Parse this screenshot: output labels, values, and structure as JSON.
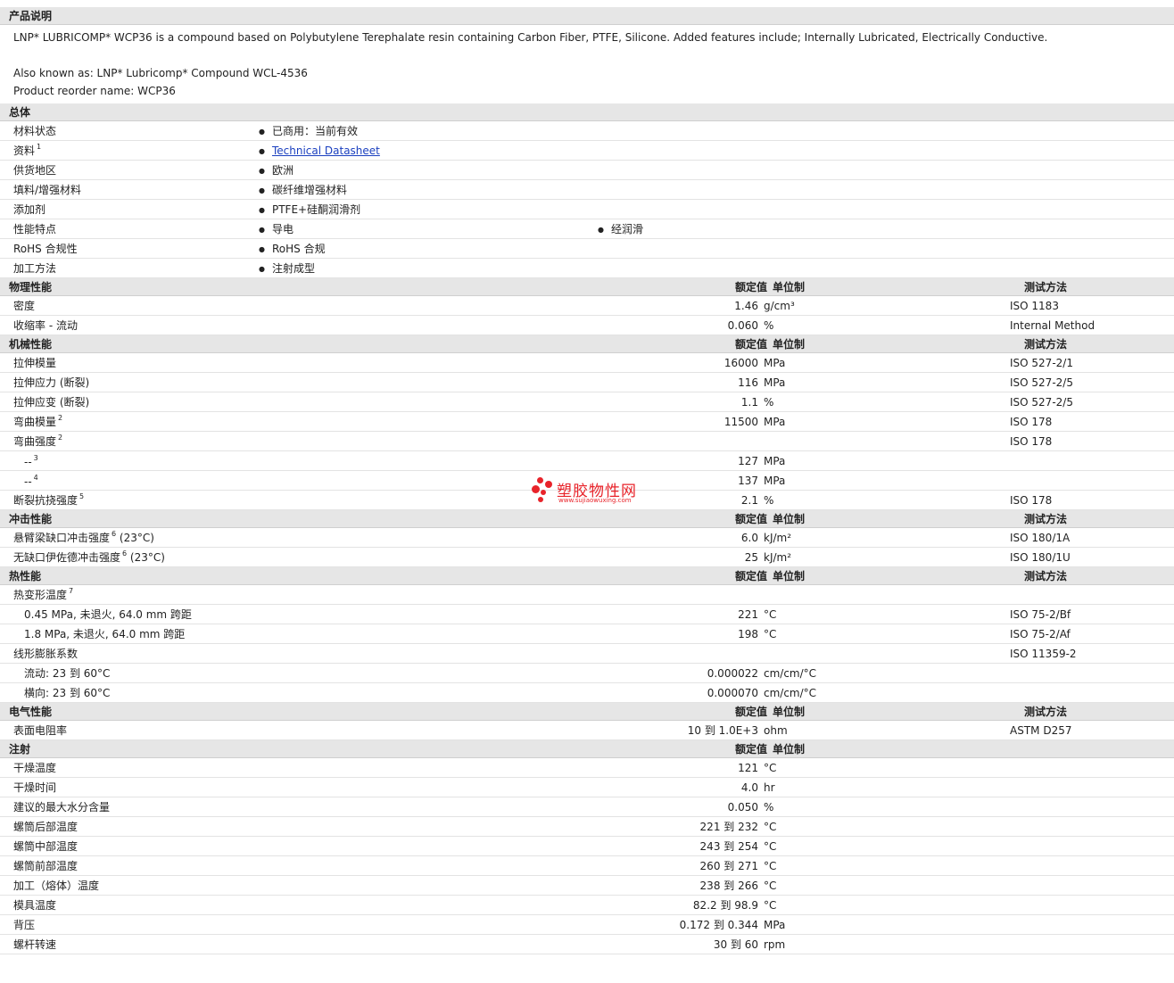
{
  "description": {
    "title": "产品说明",
    "line1": "LNP* LUBRICOMP* WCP36 is a compound based on Polybutylene Terephalate resin containing Carbon Fiber, PTFE, Silicone. Added features include; Internally Lubricated, Electrically Conductive.",
    "line2": "Also known as: LNP* Lubricomp* Compound WCL-4536",
    "line3": "Product reorder name: WCP36"
  },
  "general": {
    "title": "总体",
    "rows": [
      {
        "label": "材料状态",
        "sup": "",
        "v1": "已商用：当前有效",
        "v2": ""
      },
      {
        "label": "资料",
        "sup": "1",
        "v1": "Technical Datasheet",
        "v2": "",
        "link": true
      },
      {
        "label": "供货地区",
        "sup": "",
        "v1": "欧洲",
        "v2": ""
      },
      {
        "label": "填料/增强材料",
        "sup": "",
        "v1": "碳纤维增强材料",
        "v2": ""
      },
      {
        "label": "添加剂",
        "sup": "",
        "v1": "PTFE+硅酮润滑剂",
        "v2": ""
      },
      {
        "label": "性能特点",
        "sup": "",
        "v1": "导电",
        "v2": "经润滑"
      },
      {
        "label": "RoHS 合规性",
        "sup": "",
        "v1": "RoHS 合规",
        "v2": ""
      },
      {
        "label": "加工方法",
        "sup": "",
        "v1": "注射成型",
        "v2": ""
      }
    ]
  },
  "columns": {
    "value": "额定值",
    "unit": "单位制",
    "method": "测试方法"
  },
  "sections": [
    {
      "title": "物理性能",
      "show_method": true,
      "rows": [
        {
          "label": "密度",
          "sup": "",
          "sub": false,
          "value": "1.46",
          "unit": "g/cm³",
          "method": "ISO 1183"
        },
        {
          "label": "收缩率  - 流动",
          "sup": "",
          "sub": false,
          "value": "0.060",
          "unit": "%",
          "method": "Internal Method"
        }
      ]
    },
    {
      "title": "机械性能",
      "show_method": true,
      "rows": [
        {
          "label": "拉伸模量",
          "sup": "",
          "sub": false,
          "value": "16000",
          "unit": "MPa",
          "method": "ISO 527-2/1"
        },
        {
          "label": "拉伸应力  (断裂)",
          "sup": "",
          "sub": false,
          "value": "116",
          "unit": "MPa",
          "method": "ISO 527-2/5"
        },
        {
          "label": "拉伸应变  (断裂)",
          "sup": "",
          "sub": false,
          "value": "1.1",
          "unit": "%",
          "method": "ISO 527-2/5"
        },
        {
          "label": "弯曲模量",
          "sup": "2",
          "sub": false,
          "value": "11500",
          "unit": "MPa",
          "method": "ISO 178"
        },
        {
          "label": "弯曲强度",
          "sup": "2",
          "sub": false,
          "value": "",
          "unit": "",
          "method": "ISO 178"
        },
        {
          "label": "--",
          "sup": "3",
          "sub": true,
          "value": "127",
          "unit": "MPa",
          "method": ""
        },
        {
          "label": "--",
          "sup": "4",
          "sub": true,
          "value": "137",
          "unit": "MPa",
          "method": ""
        },
        {
          "label": "断裂抗挠强度",
          "sup": "5",
          "sub": false,
          "value": "2.1",
          "unit": "%",
          "method": "ISO 178"
        }
      ]
    },
    {
      "title": "冲击性能",
      "show_method": true,
      "rows": [
        {
          "label": "悬臂梁缺口冲击强度",
          "sup": "6",
          "after": " (23°C)",
          "sub": false,
          "value": "6.0",
          "unit": "kJ/m²",
          "method": "ISO 180/1A"
        },
        {
          "label": "无缺口伊佐德冲击强度",
          "sup": "6",
          "after": " (23°C)",
          "sub": false,
          "value": "25",
          "unit": "kJ/m²",
          "method": "ISO 180/1U"
        }
      ]
    },
    {
      "title": "热性能",
      "show_method": true,
      "rows": [
        {
          "label": "热变形温度",
          "sup": "7",
          "sub": false,
          "value": "",
          "unit": "",
          "method": ""
        },
        {
          "label": "0.45 MPa, 未退火, 64.0 mm 跨距",
          "sup": "",
          "sub": true,
          "value": "221",
          "unit": "°C",
          "method": "ISO 75-2/Bf"
        },
        {
          "label": "1.8 MPa, 未退火, 64.0 mm 跨距",
          "sup": "",
          "sub": true,
          "value": "198",
          "unit": "°C",
          "method": "ISO 75-2/Af"
        },
        {
          "label": "线形膨胀系数",
          "sup": "",
          "sub": false,
          "value": "",
          "unit": "",
          "method": "ISO 11359-2"
        },
        {
          "label": "流动: 23 到  60°C",
          "sup": "",
          "sub": true,
          "value": "0.000022",
          "unit": "cm/cm/°C",
          "method": ""
        },
        {
          "label": "横向: 23 到  60°C",
          "sup": "",
          "sub": true,
          "value": "0.000070",
          "unit": "cm/cm/°C",
          "method": ""
        }
      ]
    },
    {
      "title": "电气性能",
      "show_method": true,
      "rows": [
        {
          "label": "表面电阻率",
          "sup": "",
          "sub": false,
          "value": "10 到  1.0E+3",
          "unit": "ohm",
          "method": "ASTM D257"
        }
      ]
    },
    {
      "title": "注射",
      "show_method": false,
      "rows": [
        {
          "label": "干燥温度",
          "sup": "",
          "sub": false,
          "value": "121",
          "unit": "°C",
          "method": ""
        },
        {
          "label": "干燥时间",
          "sup": "",
          "sub": false,
          "value": "4.0",
          "unit": "hr",
          "method": ""
        },
        {
          "label": "建议的最大水分含量",
          "sup": "",
          "sub": false,
          "value": "0.050",
          "unit": "%",
          "method": ""
        },
        {
          "label": "螺筒后部温度",
          "sup": "",
          "sub": false,
          "value": "221 到  232",
          "unit": "°C",
          "method": ""
        },
        {
          "label": "螺筒中部温度",
          "sup": "",
          "sub": false,
          "value": "243 到  254",
          "unit": "°C",
          "method": ""
        },
        {
          "label": "螺筒前部温度",
          "sup": "",
          "sub": false,
          "value": "260 到  271",
          "unit": "°C",
          "method": ""
        },
        {
          "label": "加工（熔体）温度",
          "sup": "",
          "sub": false,
          "value": "238 到  266",
          "unit": "°C",
          "method": ""
        },
        {
          "label": "模具温度",
          "sup": "",
          "sub": false,
          "value": "82.2 到  98.9",
          "unit": "°C",
          "method": ""
        },
        {
          "label": "背压",
          "sup": "",
          "sub": false,
          "value": "0.172 到  0.344",
          "unit": "MPa",
          "method": ""
        },
        {
          "label": "螺杆转速",
          "sup": "",
          "sub": false,
          "value": "30 到  60",
          "unit": "rpm",
          "method": ""
        }
      ]
    }
  ],
  "watermark": {
    "cn": "塑胶物性网",
    "en": "www.sujiaowuxing.com"
  }
}
